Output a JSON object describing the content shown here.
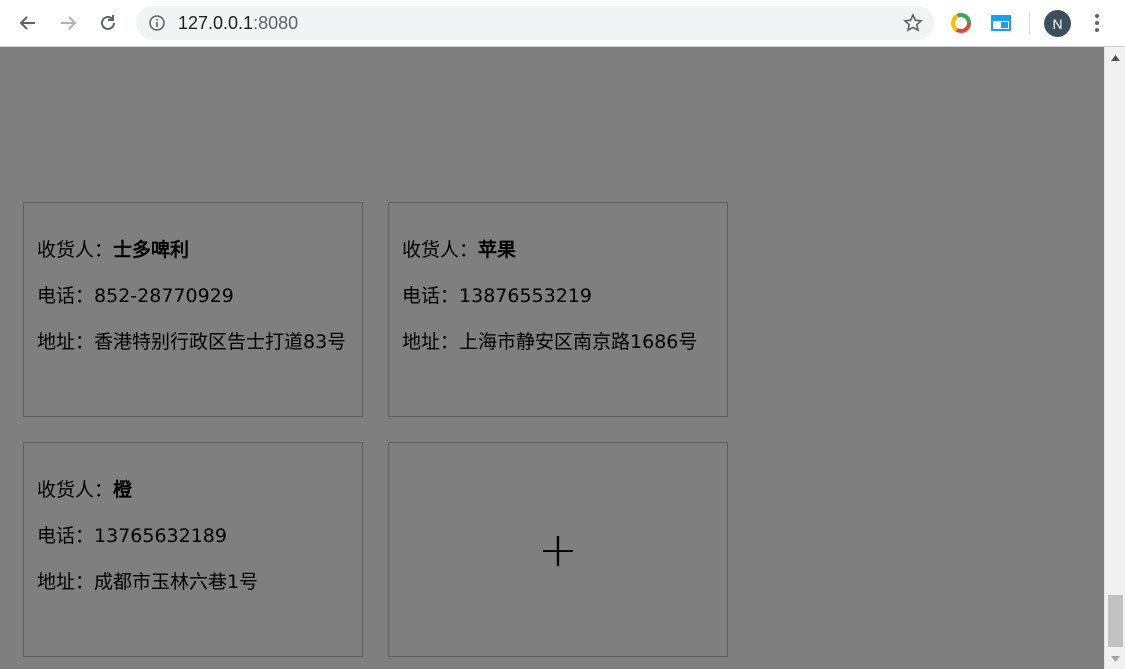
{
  "browser": {
    "url_host": "127.0.0.1",
    "url_port": ":8080",
    "profile_initial": "N",
    "icons": [
      "back-icon",
      "forward-icon",
      "reload-icon",
      "info-icon",
      "star-icon",
      "extension-icon",
      "extension-icon",
      "menu-icon"
    ]
  },
  "addresses": [
    {
      "recipient_label": "收货人：",
      "recipient": "士多啤利",
      "phone_label": "电话：",
      "phone": "852-28770929",
      "address_label": "地址：",
      "address": "香港特别行政区告士打道83号"
    },
    {
      "recipient_label": "收货人：",
      "recipient": "苹果",
      "phone_label": "电话：",
      "phone": "13876553219",
      "address_label": "地址：",
      "address": "上海市静安区南京路1686号"
    },
    {
      "recipient_label": "收货人：",
      "recipient": "橙",
      "phone_label": "电话：",
      "phone": "13765632189",
      "address_label": "地址：",
      "address": "成都市玉林六巷1号"
    }
  ],
  "add_card": {
    "symbol": "+"
  },
  "colors": {
    "overlay": "#7f7f7f",
    "border": "#5f5f5f"
  }
}
